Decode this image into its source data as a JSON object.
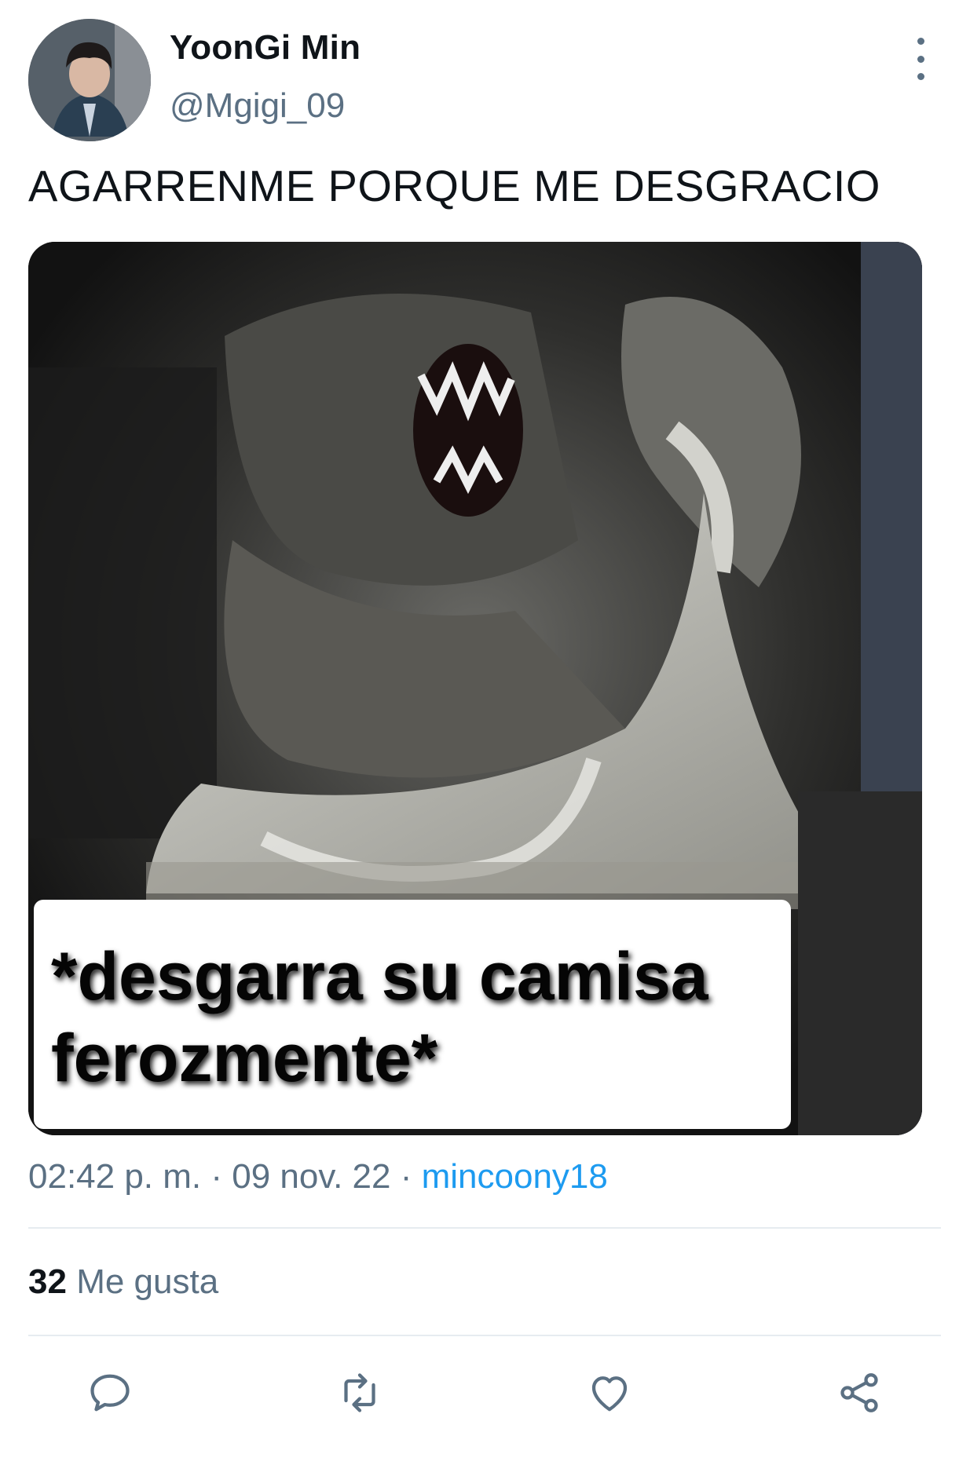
{
  "author": {
    "display_name": "YoonGi Min",
    "handle": "@Mgigi_09"
  },
  "tweet": {
    "text": "AGARRENME PORQUE ME DESGRACIO",
    "media": {
      "caption_line1": "*desgarra su camisa",
      "caption_line2": "ferozmente*"
    },
    "time": "02:42 p. m.",
    "separator": "·",
    "date": "09 nov. 22",
    "source": "mincoony18"
  },
  "stats": {
    "likes_count": "32",
    "likes_label": "Me gusta"
  },
  "actions": [
    {
      "icon": "reply-icon"
    },
    {
      "icon": "retweet-icon"
    },
    {
      "icon": "heart-icon"
    },
    {
      "icon": "share-icon"
    }
  ],
  "colors": {
    "text_primary": "#0f1419",
    "text_secondary": "#5b7083",
    "link": "#1d9bf0",
    "divider": "#e6ecf0"
  }
}
